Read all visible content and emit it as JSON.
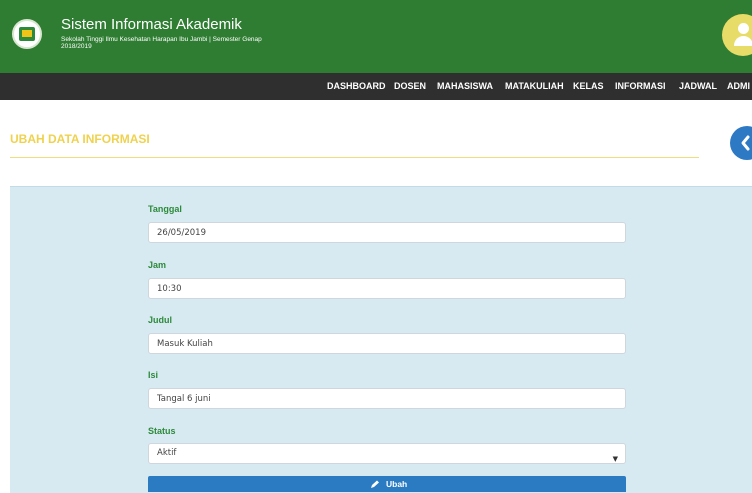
{
  "header": {
    "title": "Sistem Informasi Akademik",
    "subtitle_line1": "Sekolah Tinggi Ilmu Kesehatan Harapan Ibu Jambi | Semester Genap",
    "subtitle_line2": "2018/2019"
  },
  "nav": {
    "items": [
      "DASHBOARD",
      "DOSEN",
      "MAHASISWA",
      "MATAKULIAH",
      "KELAS",
      "INFORMASI",
      "JADWAL",
      "ADMI"
    ]
  },
  "page": {
    "title": "UBAH DATA INFORMASI"
  },
  "form": {
    "tanggal": {
      "label": "Tanggal",
      "value": "26/05/2019"
    },
    "jam": {
      "label": "Jam",
      "value": "10:30"
    },
    "judul": {
      "label": "Judul",
      "value": "Masuk Kuliah"
    },
    "isi": {
      "label": "Isi",
      "value": "Tangal 6 juni"
    },
    "status": {
      "label": "Status",
      "value": "Aktif"
    },
    "submit_label": "Ubah"
  },
  "colors": {
    "header_bg": "#2f7d32",
    "nav_bg": "#2f2f2f",
    "title_accent": "#efd24e",
    "panel_bg": "#d7eaf2",
    "label_green": "#2d8a3a",
    "button_blue": "#2b7bc2"
  },
  "icons": [
    "school-logo-icon",
    "user-avatar-icon",
    "chevron-left-icon",
    "pencil-icon",
    "caret-down-icon"
  ]
}
